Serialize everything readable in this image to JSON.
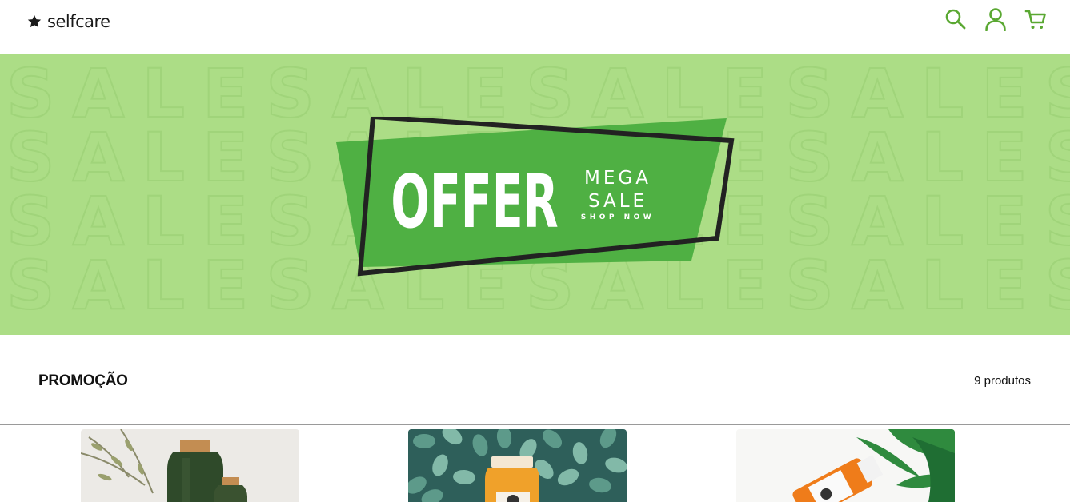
{
  "header": {
    "logo_text": "selfcare",
    "icons": [
      "search-icon",
      "user-icon",
      "cart-icon"
    ],
    "accent_color": "#5aa832"
  },
  "banner": {
    "background_color": "#acdd86",
    "pattern_word": "SALE",
    "headline": "OFFER",
    "line1": "MEGA",
    "line2": "SALE",
    "cta": "SHOP NOW",
    "tag_color": "#4fb043"
  },
  "section": {
    "title": "PROMOÇÃO",
    "count": "9 produtos"
  },
  "products": [
    {
      "name": "green-juice-bottles-card"
    },
    {
      "name": "orange-juice-leaves-card"
    },
    {
      "name": "orange-juice-plant-card"
    }
  ]
}
